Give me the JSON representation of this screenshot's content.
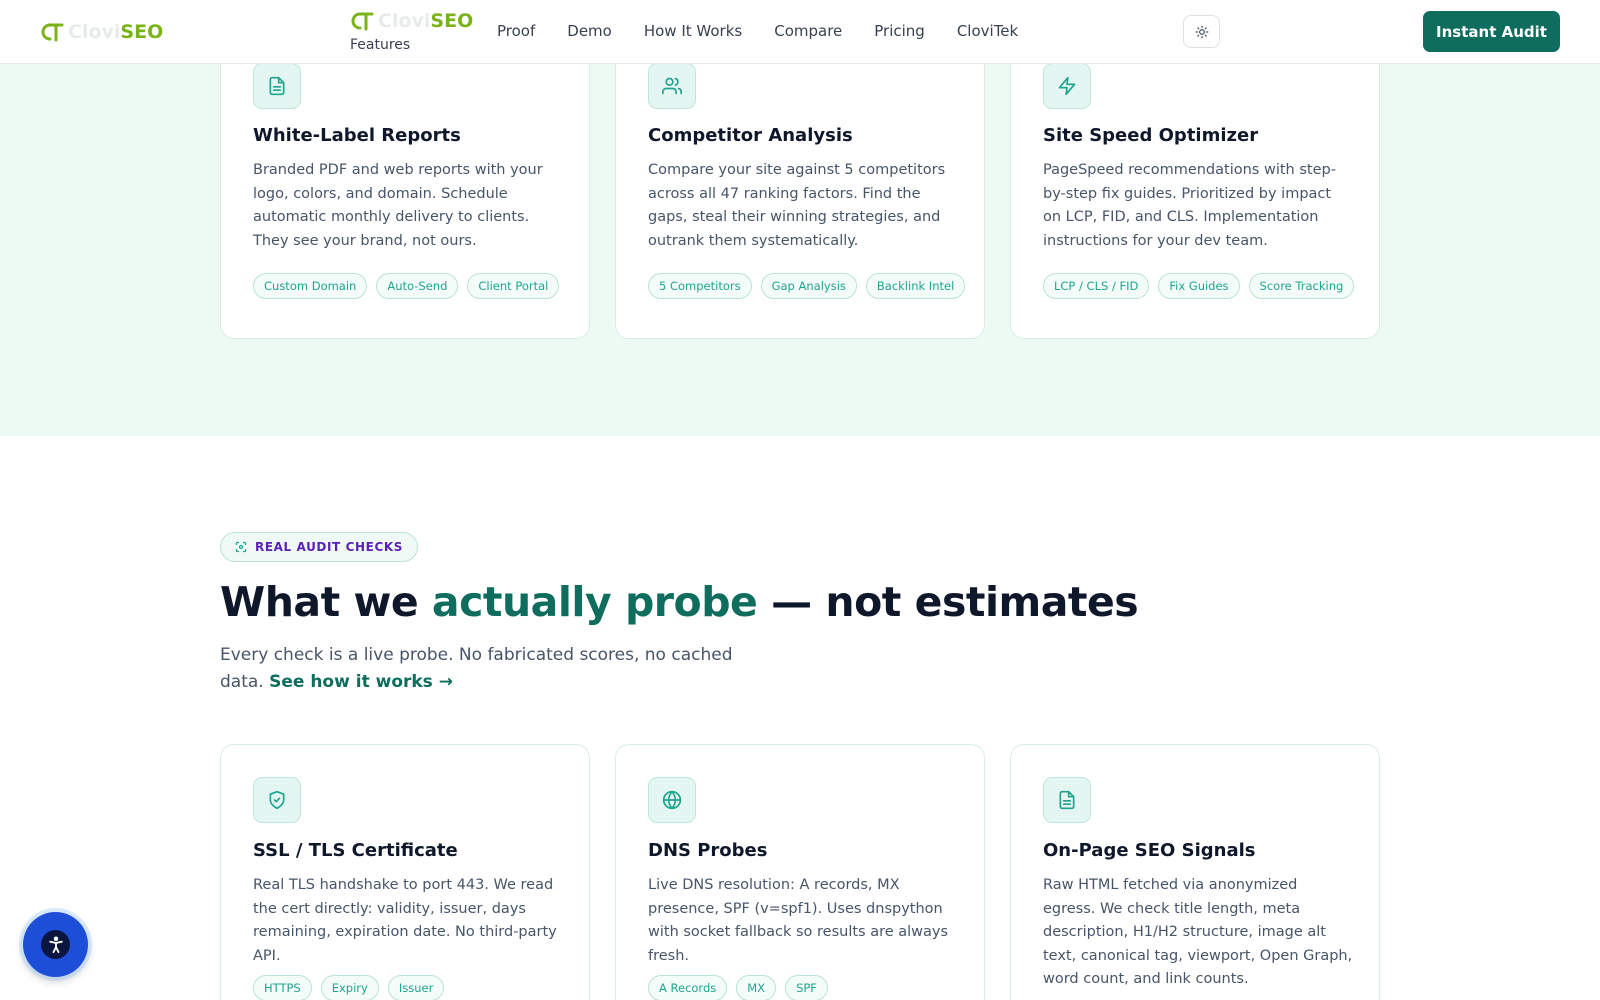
{
  "brand": {
    "name_part1": "Clovi",
    "name_part2": "SEO"
  },
  "nav": {
    "features": "Features",
    "items": [
      "Proof",
      "Demo",
      "How It Works",
      "Compare",
      "Pricing",
      "CloviTek"
    ],
    "cta": "Instant Audit"
  },
  "feature_cards": [
    {
      "title": "White-Label Reports",
      "icon": "document-icon",
      "description": "Branded PDF and web reports with your logo, colors, and domain. Schedule automatic monthly delivery to clients. They see your brand, not ours.",
      "tags": [
        "Custom Domain",
        "Auto-Send",
        "Client Portal"
      ]
    },
    {
      "title": "Competitor Analysis",
      "icon": "users-icon",
      "description": "Compare your site against 5 competitors across all 47 ranking factors. Find the gaps, steal their winning strategies, and outrank them systematically.",
      "tags": [
        "5 Competitors",
        "Gap Analysis",
        "Backlink Intel"
      ]
    },
    {
      "title": "Site Speed Optimizer",
      "icon": "lightning-icon",
      "description": "PageSpeed recommendations with step-by-step fix guides. Prioritized by impact on LCP, FID, and CLS. Implementation instructions for your dev team.",
      "tags": [
        "LCP / CLS / FID",
        "Fix Guides",
        "Score Tracking"
      ]
    }
  ],
  "audit_section": {
    "badge": "REAL AUDIT CHECKS",
    "headline_before": "What we ",
    "headline_accent": "actually probe",
    "headline_after": " — not estimates",
    "subtitle": "Every check is a live probe. No fabricated scores, no cached data. ",
    "subtitle_link": "See how it works →"
  },
  "audit_cards": [
    {
      "title": "SSL / TLS Certificate",
      "icon": "shield-check-icon",
      "description": "Real TLS handshake to port 443. We read the cert directly: validity, issuer, days remaining, expiration date. No third-party API.",
      "tags": [
        "HTTPS",
        "Expiry",
        "Issuer"
      ]
    },
    {
      "title": "DNS Probes",
      "icon": "globe-icon",
      "description": "Live DNS resolution: A records, MX presence, SPF (v=spf1). Uses dnspython with socket fallback so results are always fresh.",
      "tags": [
        "A Records",
        "MX",
        "SPF"
      ]
    },
    {
      "title": "On-Page SEO Signals",
      "icon": "document-icon",
      "description": "Raw HTML fetched via anonymized egress. We check title length, meta description, H1/H2 structure, image alt text, canonical tag, viewport, Open Graph, word count, and link counts.",
      "tags": []
    }
  ],
  "colors": {
    "accent": "#0e6d5d",
    "brand_green": "#7ab317",
    "tag_text": "#1fa48f",
    "section_bg": "#ecfaf3"
  }
}
